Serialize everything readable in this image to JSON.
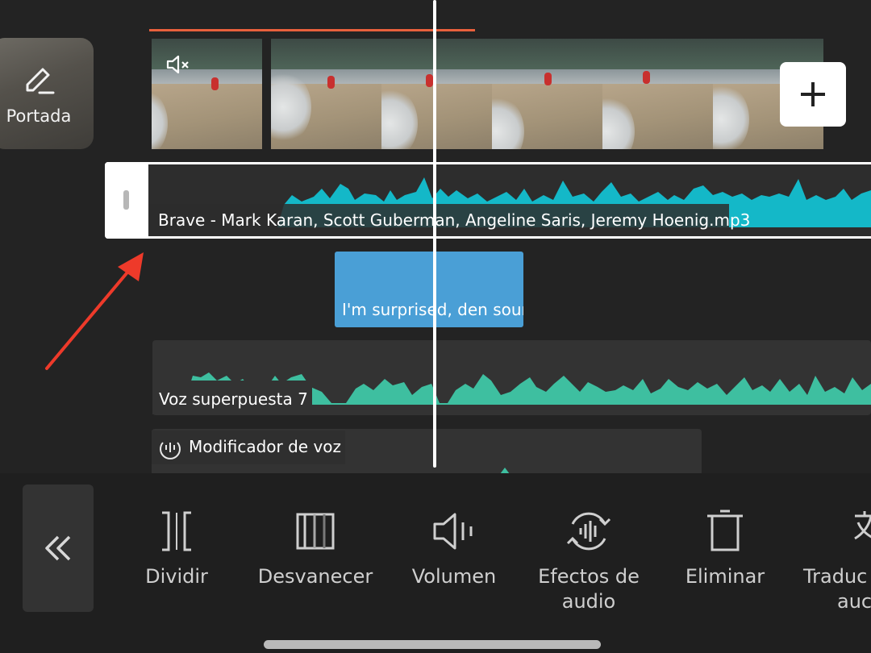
{
  "cover": {
    "label": "Portada",
    "icon": "pencil-icon"
  },
  "timeline": {
    "video": {
      "muted_icon": "mute-icon",
      "add_icon": "plus-icon"
    },
    "music_track": {
      "label": "Brave - Mark Karan, Scott Guberman, Angeline Saris, Jeremy Hoenig.mp3",
      "wave_color": "#14b8c8"
    },
    "text_clip": {
      "label": "I'm surprised, den sound",
      "color": "#4a9fd6"
    },
    "voice_track": {
      "label": "Voz superpuesta 7",
      "wave_color": "#3ebfa0"
    },
    "modifier_track": {
      "label": "Modificador de voz",
      "icon": "voice-modifier-icon"
    }
  },
  "annotation": {
    "arrow_color": "#ee3a2a"
  },
  "toolbar": {
    "back_icon": "double-chevron-left-icon",
    "tools": [
      {
        "label": "Dividir",
        "icon": "split-icon"
      },
      {
        "label": "Desvanecer",
        "icon": "fade-icon"
      },
      {
        "label": "Volumen",
        "icon": "volume-icon"
      },
      {
        "label": "Efectos de audio",
        "label_line1": "Efectos de",
        "label_line2": "audio",
        "icon": "audio-effects-icon"
      },
      {
        "label": "Eliminar",
        "icon": "delete-icon"
      },
      {
        "label": "Traducir audio",
        "label_line1": "Traduc",
        "label_line2": "auc",
        "icon": "translate-icon"
      }
    ]
  }
}
